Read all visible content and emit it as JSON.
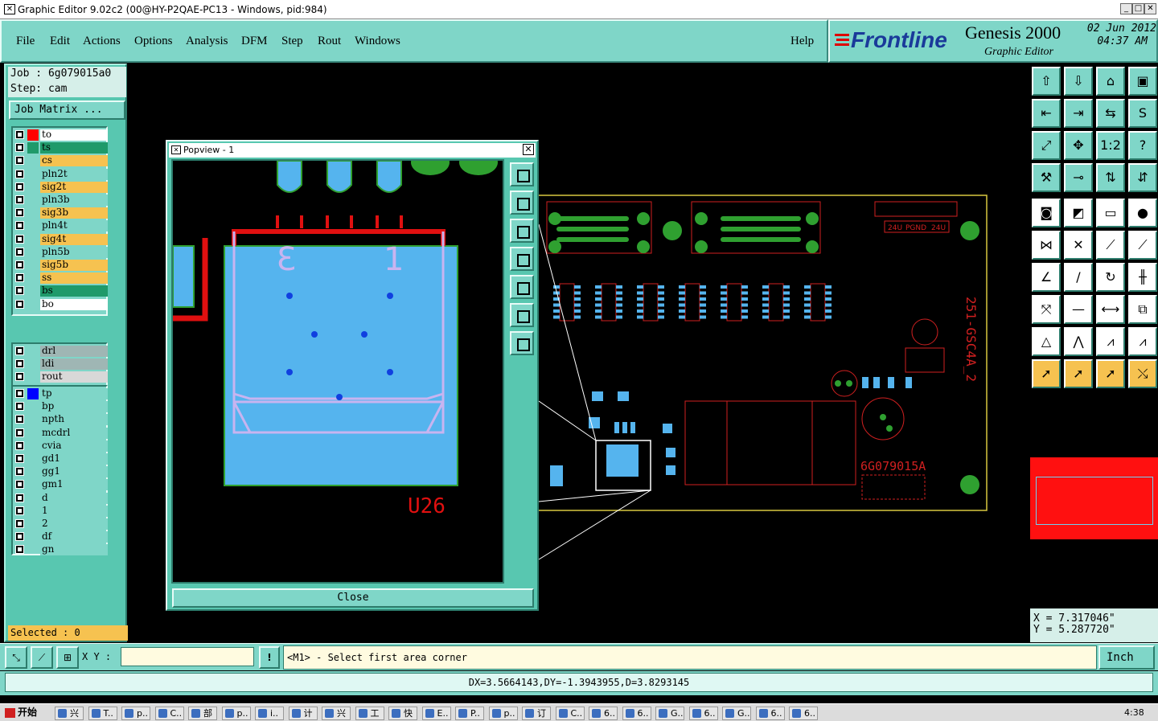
{
  "window": {
    "title": "Graphic Editor 9.02c2 (00@HY-P2QAE-PC13 - Windows, pid:984)"
  },
  "menu": [
    "File",
    "Edit",
    "Actions",
    "Options",
    "Analysis",
    "DFM",
    "Step",
    "Rout",
    "Windows"
  ],
  "help_label": "Help",
  "brand": {
    "logo": "Frontline",
    "product": "Genesis 2000",
    "subtitle": "Graphic Editor",
    "date": "02 Jun 2012",
    "time": "04:37 AM"
  },
  "job": {
    "job_label": "Job : 6g079015a0",
    "step_label": "Step: cam",
    "matrix_button": "Job Matrix ..."
  },
  "layers_group1": [
    {
      "name": "to",
      "color": "#ffffff",
      "swatch": "#ff0000",
      "active": true
    },
    {
      "name": "ts",
      "color": "#1f9a6a",
      "swatch": "#1f9a6a"
    },
    {
      "name": "cs",
      "color": "#f6c250",
      "swatch": ""
    },
    {
      "name": "pln2t",
      "color": "#7fd6c8",
      "swatch": ""
    },
    {
      "name": "sig2t",
      "color": "#f6c250",
      "swatch": ""
    },
    {
      "name": "pln3b",
      "color": "#7fd6c8",
      "swatch": ""
    },
    {
      "name": "sig3b",
      "color": "#f6c250",
      "swatch": ""
    },
    {
      "name": "pln4t",
      "color": "#7fd6c8",
      "swatch": ""
    },
    {
      "name": "sig4t",
      "color": "#f6c250",
      "swatch": ""
    },
    {
      "name": "pln5b",
      "color": "#7fd6c8",
      "swatch": ""
    },
    {
      "name": "sig5b",
      "color": "#f6c250",
      "swatch": ""
    },
    {
      "name": "ss",
      "color": "#f6c250",
      "swatch": ""
    },
    {
      "name": "bs",
      "color": "#1f9a6a",
      "swatch": ""
    },
    {
      "name": "bo",
      "color": "#ffffff",
      "swatch": ""
    }
  ],
  "layers_group2": [
    {
      "name": "drl",
      "color": "#9fb6b4"
    },
    {
      "name": "ldi",
      "color": "#9fb6b4"
    },
    {
      "name": "rout",
      "color": "#d8d8d8"
    }
  ],
  "layers_group3": [
    {
      "name": "tp",
      "color": "#7fd6c8",
      "swatch": "#0000ff"
    },
    {
      "name": "bp",
      "color": "#7fd6c8"
    },
    {
      "name": "npth",
      "color": "#7fd6c8"
    },
    {
      "name": "mcdrl",
      "color": "#7fd6c8"
    },
    {
      "name": "cvia",
      "color": "#7fd6c8"
    },
    {
      "name": "gd1",
      "color": "#7fd6c8"
    },
    {
      "name": "gg1",
      "color": "#7fd6c8"
    },
    {
      "name": "gm1",
      "color": "#7fd6c8"
    },
    {
      "name": "d",
      "color": "#7fd6c8"
    },
    {
      "name": "1",
      "color": "#7fd6c8"
    },
    {
      "name": "2",
      "color": "#7fd6c8"
    },
    {
      "name": "df",
      "color": "#7fd6c8"
    },
    {
      "name": "gn",
      "color": "#7fd6c8"
    }
  ],
  "selected": "Selected : 0",
  "popview": {
    "title": "Popview - 1",
    "close_label": "Close",
    "component_label": "U26",
    "pin_left": "3",
    "pin_right": "1"
  },
  "pcb": {
    "board_text": "251-GSC4A_2",
    "part_number": "6G079015A",
    "labels": [
      "24U",
      "PGND",
      "24U"
    ]
  },
  "coords": {
    "x": "X = 7.317046\"",
    "y": "Y = 5.287720\""
  },
  "cmd": {
    "xy_label": "X Y :",
    "xy_value": "",
    "prompt": "<M1> - Select first area corner",
    "units": "Inch"
  },
  "status": "DX=3.5664143,DY=-1.3943955,D=3.8293145",
  "taskbar": {
    "start": "开始",
    "clock": "4:38",
    "tasks": [
      "兴",
      "T..",
      "p..",
      "C..",
      "部",
      "p..",
      "i..",
      "计",
      "兴",
      "工",
      "快",
      "E..",
      "P..",
      "p..",
      "订",
      "C..",
      "6..",
      "6..",
      "G..",
      "6..",
      "G..",
      "6..",
      "6.."
    ]
  }
}
